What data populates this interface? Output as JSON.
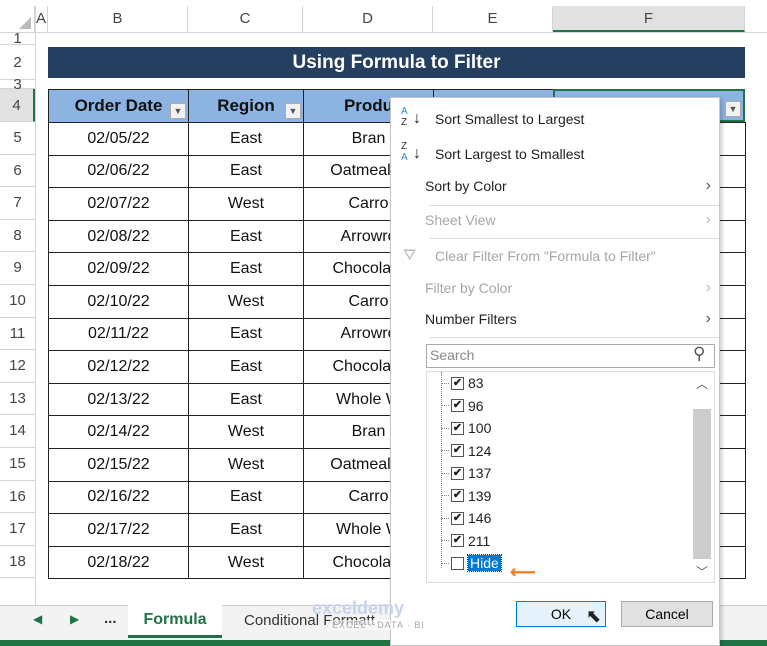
{
  "columns": [
    "A",
    "B",
    "C",
    "D",
    "E",
    "F"
  ],
  "rows": [
    "1",
    "2",
    "3",
    "4",
    "5",
    "6",
    "7",
    "8",
    "9",
    "10",
    "11",
    "12",
    "13",
    "14",
    "15",
    "16",
    "17",
    "18"
  ],
  "title": "Using Formula to Filter",
  "headers": [
    "Order Date",
    "Region",
    "Produ"
  ],
  "data": [
    [
      "02/05/22",
      "East",
      "Bran"
    ],
    [
      "02/06/22",
      "East",
      "Oatmeal R"
    ],
    [
      "02/07/22",
      "West",
      "Carro"
    ],
    [
      "02/08/22",
      "East",
      "Arrowro"
    ],
    [
      "02/09/22",
      "East",
      "Chocolate"
    ],
    [
      "02/10/22",
      "West",
      "Carro"
    ],
    [
      "02/11/22",
      "East",
      "Arrowro"
    ],
    [
      "02/12/22",
      "East",
      "Chocolate"
    ],
    [
      "02/13/22",
      "East",
      "Whole W"
    ],
    [
      "02/14/22",
      "West",
      "Bran"
    ],
    [
      "02/15/22",
      "West",
      "Oatmeal R"
    ],
    [
      "02/16/22",
      "East",
      "Carro"
    ],
    [
      "02/17/22",
      "East",
      "Whole W"
    ],
    [
      "02/18/22",
      "West",
      "Chocolate"
    ]
  ],
  "menu": {
    "sort_asc": "Sort Smallest to Largest",
    "sort_desc": "Sort Largest to Smallest",
    "sort_color": "Sort by Color",
    "sheet_view": "Sheet View",
    "clear_filter": "Clear Filter From \"Formula to Filter\"",
    "filter_color": "Filter by Color",
    "number_filters": "Number Filters",
    "search_placeholder": "Search",
    "items": [
      {
        "label": "83",
        "checked": true
      },
      {
        "label": "96",
        "checked": true
      },
      {
        "label": "100",
        "checked": true
      },
      {
        "label": "124",
        "checked": true
      },
      {
        "label": "137",
        "checked": true
      },
      {
        "label": "139",
        "checked": true
      },
      {
        "label": "146",
        "checked": true
      },
      {
        "label": "211",
        "checked": true
      },
      {
        "label": "Hide",
        "checked": false
      }
    ],
    "ok": "OK",
    "cancel": "Cancel"
  },
  "tabs": {
    "nav_more": "...",
    "active": "Formula",
    "other": "Conditional Formatt"
  },
  "watermark": {
    "name": "exceldemy",
    "sub": "EXCEL · DATA · BI"
  },
  "colors": {
    "title_bg": "#243f60",
    "header_bg": "#8db3e2",
    "accent": "#217346",
    "highlight": "#0078d7",
    "arrow": "#f47c20"
  }
}
